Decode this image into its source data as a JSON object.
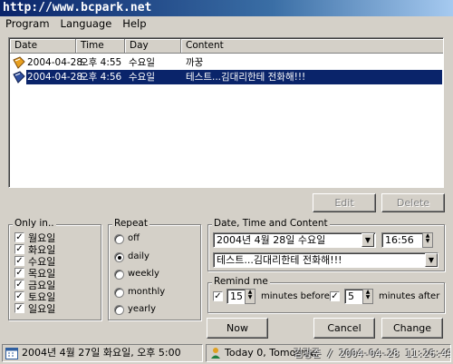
{
  "title": "http://www.bcpark.net",
  "menu": [
    "Program",
    "Language",
    "Help"
  ],
  "list": {
    "columns": [
      "Date",
      "Time",
      "Day",
      "Content"
    ],
    "rows": [
      {
        "date": "2004-04-28",
        "time": "오후 4:55",
        "day": "수요일",
        "content": "까꿍",
        "selected": false
      },
      {
        "date": "2004-04-28",
        "time": "오후 4:56",
        "day": "수요일",
        "content": "테스트...김대리한테 전화해!!!",
        "selected": true
      }
    ]
  },
  "buttons": {
    "edit": "Edit",
    "delete": "Delete",
    "now": "Now",
    "cancel": "Cancel",
    "change": "Change"
  },
  "only_in": {
    "legend": "Only in..",
    "days": [
      {
        "label": "월요일",
        "checked": true
      },
      {
        "label": "화요일",
        "checked": true
      },
      {
        "label": "수요일",
        "checked": true
      },
      {
        "label": "목요일",
        "checked": true
      },
      {
        "label": "금요일",
        "checked": true
      },
      {
        "label": "토요일",
        "checked": true
      },
      {
        "label": "일요일",
        "checked": true
      }
    ]
  },
  "repeat": {
    "legend": "Repeat",
    "options": [
      "off",
      "daily",
      "weekly",
      "monthly",
      "yearly"
    ],
    "selected": "daily"
  },
  "datetime": {
    "legend": "Date, Time and Content",
    "date": "2004년   4월 28일 수요일",
    "time": "16:56",
    "content": "테스트...김대리한테 전화해!!!"
  },
  "remind": {
    "legend": "Remind me",
    "before_checked": true,
    "before_value": "15",
    "before_label": "minutes before",
    "after_checked": true,
    "after_value": "5",
    "after_label": "minutes after"
  },
  "status": {
    "left": "2004년 4월 27일 화요일, 오후 5:00",
    "right": "Today 0, Tomorrow",
    "watermark": "김광준 / 2004-04-28 11:26:49"
  },
  "colors": {
    "selection": "#0a246a",
    "face": "#d4d0c8",
    "title_start": "#0a246a",
    "title_end": "#a6caf0"
  }
}
